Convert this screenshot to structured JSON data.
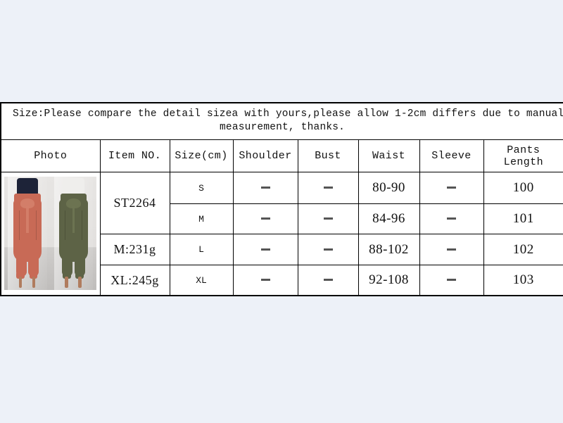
{
  "page": {
    "background_color": "#edf1f8"
  },
  "size_chart": {
    "note": {
      "line1": "Size:Please compare the detail sizea with yours,please allow 1-2cm differs due to manual",
      "line2": "measurement, thanks."
    },
    "columns": [
      "Photo",
      "Item NO.",
      "Size(cm)",
      "Shoulder",
      "Bust",
      "Waist",
      "Sleeve",
      "Pants Length"
    ],
    "photo": {
      "alt": "Two models wearing paperbag-waist tie belt cargo pants",
      "variants": [
        {
          "name": "terracotta-pants",
          "color": "#c86a56",
          "top_color": "#1d2338"
        },
        {
          "name": "olive-pants",
          "color": "#5d6346",
          "top_color": "#efeeec"
        }
      ]
    },
    "item_no": "ST2264",
    "weights": [
      "M:231g",
      "XL:245g"
    ],
    "rows": [
      {
        "size": "S",
        "shoulder": "–",
        "bust": "–",
        "waist": "80-90",
        "sleeve": "–",
        "pants_length": "100"
      },
      {
        "size": "M",
        "shoulder": "–",
        "bust": "–",
        "waist": "84-96",
        "sleeve": "–",
        "pants_length": "101"
      },
      {
        "size": "L",
        "shoulder": "–",
        "bust": "–",
        "waist": "88-102",
        "sleeve": "–",
        "pants_length": "102"
      },
      {
        "size": "XL",
        "shoulder": "–",
        "bust": "–",
        "waist": "92-108",
        "sleeve": "–",
        "pants_length": "103"
      }
    ]
  }
}
